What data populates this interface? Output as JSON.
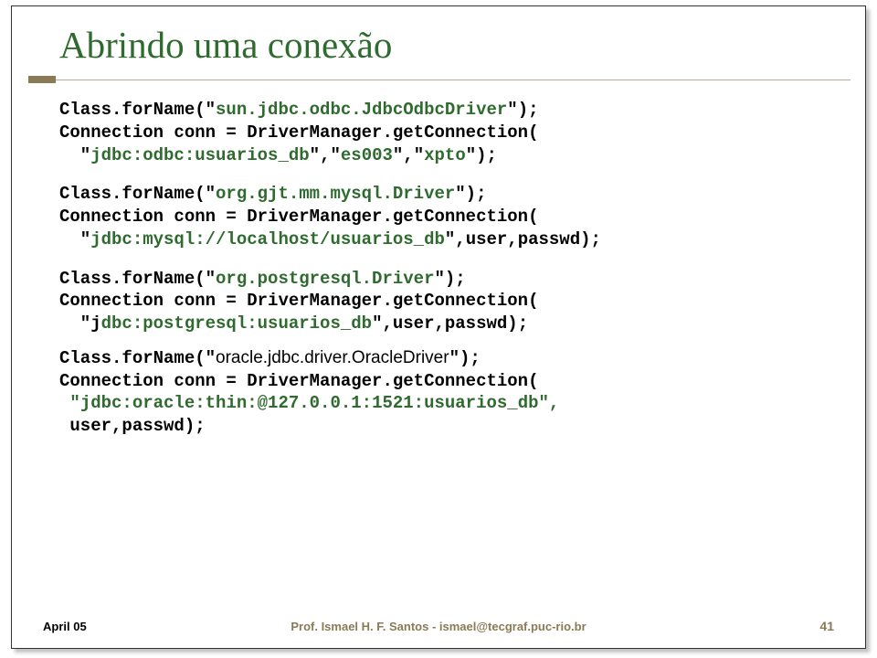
{
  "title": "Abrindo uma conexão",
  "code": {
    "odbc": {
      "l1a": "Class.forName(\"",
      "l1b": "sun.jdbc.odbc.JdbcOdbcDriver",
      "l1c": "\");",
      "l2": "Connection conn = DriverManager.getConnection(",
      "l3a": "  \"",
      "l3b": "jdbc:odbc:usuarios_db",
      "l3c": "\",\"",
      "l3d": "es003",
      "l3e": "\",\"",
      "l3f": "xpto",
      "l3g": "\");"
    },
    "mysql": {
      "l1a": "Class.forName(\"",
      "l1b": "org.gjt.mm.mysql.Driver",
      "l1c": "\");",
      "l2": "Connection conn = DriverManager.getConnection(",
      "l3a": "  \"",
      "l3b": "jdbc:mysql://localhost/usuarios_db",
      "l3c": "\",user,passwd);"
    },
    "pg": {
      "l1a": "Class.forName(\"",
      "l1b": "org.postgresql.Driver",
      "l1c": "\");",
      "l2": "Connection conn = DriverManager.getConnection(",
      "l3a": "  \"j",
      "l3b": "dbc:postgresql:usuarios_db",
      "l3c": "\",user,passwd);"
    },
    "oracle": {
      "l1a": "Class.forName(\"",
      "l1b": "oracle.jdbc.driver.OracleDriver",
      "l1c": "\");",
      "l2": "Connection conn = DriverManager.getConnection(",
      "l3a": " \"",
      "l3b": "jdbc:oracle:thin:@127.0.0.1:1521:usuarios_db",
      "l3c": "\",",
      "l4": " user,passwd);"
    }
  },
  "footer": {
    "date": "April 05",
    "author": "Prof. Ismael H. F. Santos - ismael@tecgraf.puc-rio.br",
    "page": "41"
  }
}
